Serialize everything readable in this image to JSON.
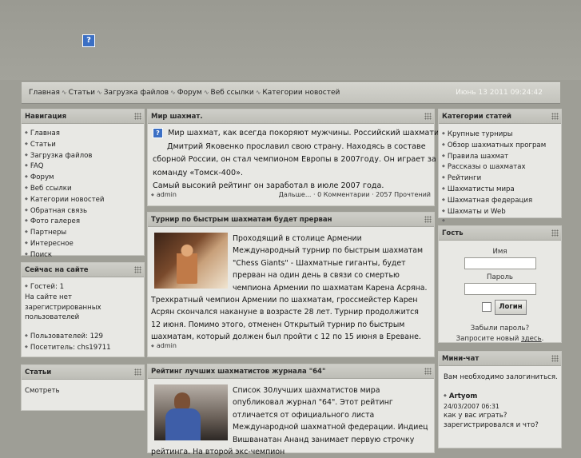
{
  "header": {
    "logo_icon": "question-mark-icon"
  },
  "nav": {
    "items": [
      "Главная",
      "Статьи",
      "Загрузка файлов",
      "Форум",
      "Веб ссылки",
      "Категории новостей"
    ],
    "datetime": "Июнь 13 2011 09:24:42"
  },
  "navigation": {
    "title": "Навигация",
    "items": [
      "Главная",
      "Статьи",
      "Загрузка файлов",
      "FAQ",
      "Форум",
      "Веб ссылки",
      "Категории новостей",
      "Обратная связь",
      "Фото галерея",
      "Партнеры",
      "Интересное",
      "Поиск"
    ]
  },
  "online": {
    "title": "Сейчас на сайте",
    "guests": "Гостей: 1",
    "reg_line1": "На сайте нет",
    "reg_line2": "зарегистрированных",
    "reg_line3": "пользователей",
    "users": "Пользователей: 129",
    "visitor": "Посетитель: chs19711"
  },
  "articles_box": {
    "title": "Статьи",
    "link": "Смотреть"
  },
  "articles": [
    {
      "title": "Мир шахмат.",
      "line1": "Мир шахмат, как всегда покоряют мужчины. Российский шахматист",
      "line2": "Дмитрий Яковенко прославил свою страну. Находясь в составе",
      "line3": "сборной России, он стал чемпионом Европы в  2007году. Он играет за",
      "line4": "команду «Томск-400».",
      "line5": "Самый высокий рейтинг он заработал в июле 2007 года.",
      "author": "admin",
      "meta": "Дальше... · 0 Комментарии · 2057 Прочтений"
    },
    {
      "title": "Турнир по быстрым шахматам будет прерван",
      "text": "Проходящий в столице Армении Международный турнир по быстрым шахматам   \"Chess   Giants\"   - Шахматные гиганты, будет прерван на один день в связи со смертью чемпиона Армении по шахматам Карена Асряна. Трехкратный чемпион Армении по шахматам, гроссмейстер Карен Асрян скончался накануне в возрасте 28 лет. Турнир продолжится 12 июня. Помимо этого, отменен Открытый турнир по быстрым шахматам, который должен был пройти с 12 по 15 июня в Ереване.",
      "author": "admin"
    },
    {
      "title": "Рейтинг лучших шахматистов журнала \"64\"",
      "text": "Список   30лучших шахматистов мира опубликовал журнал     \"64\". Этот рейтинг отличается от официального листа Международной шахматной федерации. Индиец Вишванатан Ананд занимает первую строчку рейтинга. На второй экс-чемпион"
    }
  ],
  "categories": {
    "title": "Категории статей",
    "items": [
      "Крупные турниры",
      "Обзор шахматных програм",
      "Правила шахмат",
      "Рассказы о шахматах",
      "Рейтинги",
      "Шахматисты мира",
      "Шахматная федерация",
      "Шахматы и Web"
    ]
  },
  "guest": {
    "title": "Гость",
    "name_label": "Имя",
    "password_label": "Пароль",
    "login_button": "Логин",
    "forgot": "Забыли пароль?",
    "request_prefix": "Запросите новый ",
    "request_link": "здесь",
    "request_suffix": "."
  },
  "minichat": {
    "title": "Мини-чат",
    "notice": "Вам необходимо залогиниться.",
    "author": "Artyom",
    "date": "24/03/2007 06:31",
    "msg1": "как у вас играть?",
    "msg2": "зарегистрировался и что?"
  },
  "colors": {
    "page_bg": "#9e9e96",
    "panel_bg": "#e8e8e4",
    "header_bg": "#c6c6c0",
    "icon_blue": "#3b6fc4"
  }
}
